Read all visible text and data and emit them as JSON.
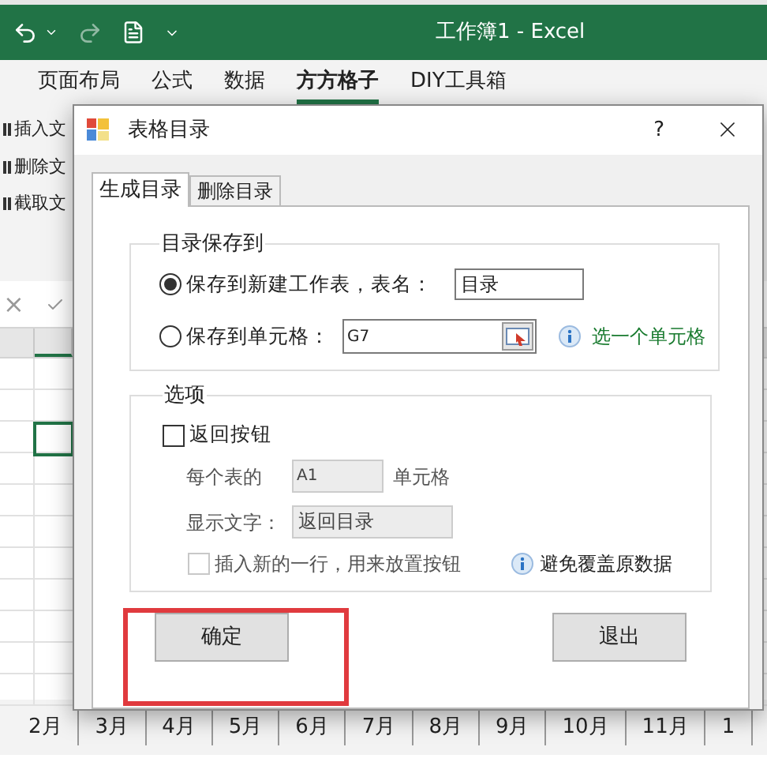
{
  "excel": {
    "title": "工作簿1 - Excel",
    "ribbon_tabs": [
      {
        "label": "页面布局",
        "selected": false
      },
      {
        "label": "公式",
        "selected": false
      },
      {
        "label": "数据",
        "selected": false
      },
      {
        "label": "方方格子",
        "selected": true
      },
      {
        "label": "DIY工具箱",
        "selected": false
      }
    ],
    "ribbon_commands": [
      "插入文",
      "删除文",
      "截取文"
    ],
    "formula_bar": {
      "cancel": "×"
    },
    "sheet_tabs": [
      "2月",
      "3月",
      "4月",
      "5月",
      "6月",
      "7月",
      "8月",
      "9月",
      "10月",
      "11月",
      "1"
    ]
  },
  "dialog": {
    "title": "表格目录",
    "help": "?",
    "tabs": [
      {
        "label": "生成目录",
        "selected": true
      },
      {
        "label": "删除目录",
        "selected": false
      }
    ],
    "save_group": {
      "title": "目录保存到",
      "options": [
        {
          "label": "保存到新建工作表，表名：",
          "selected": true,
          "value": "目录"
        },
        {
          "label": "保存到单元格：",
          "selected": false,
          "value": "G7"
        }
      ],
      "hint": "选一个单元格"
    },
    "options_group": {
      "title": "选项",
      "return_button": {
        "label": "返回按钮",
        "checked": false
      },
      "cell_row": {
        "label": "每个表的",
        "value": "A1",
        "suffix": "单元格",
        "disabled": true
      },
      "text_row": {
        "label": "显示文字：",
        "value": "返回目录",
        "disabled": true
      },
      "insert_row": {
        "label": "插入新的一行，用来放置按钮",
        "checked": false,
        "disabled": true
      },
      "note": "避免覆盖原数据"
    },
    "buttons": [
      "确定",
      "退出"
    ]
  }
}
